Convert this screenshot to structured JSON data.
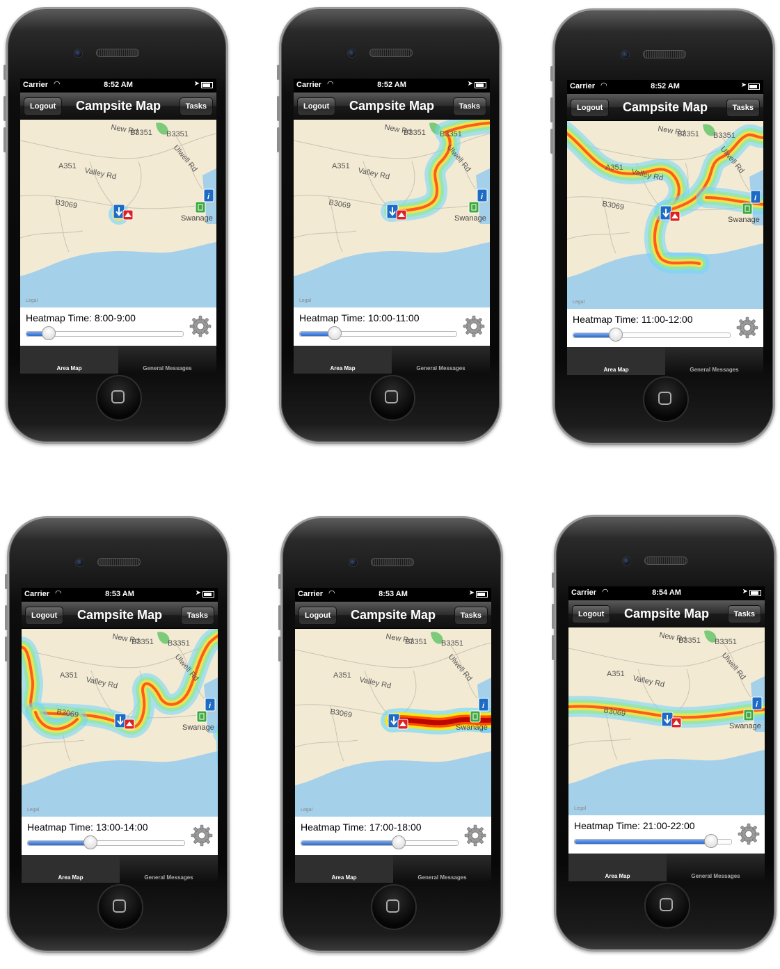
{
  "app": {
    "nav_title": "Campsite Map",
    "logout_label": "Logout",
    "tasks_label": "Tasks",
    "carrier": "Carrier",
    "map_legal": "Legal",
    "tab_area_map": "Area Map",
    "tab_general_messages": "General Messages",
    "slider_accent": "#2a69d3"
  },
  "map_labels": {
    "road_new": "New Rd",
    "b3351": "B3351",
    "b3351_b": "B3351",
    "ulwell": "Ulwell Rd",
    "a351": "A351",
    "valley": "Valley Rd",
    "b3069": "B3069",
    "swanage": "Swanage"
  },
  "screens": [
    {
      "time": "8:52 AM",
      "heatmap_label": "Heatmap Time: 8:00-9:00",
      "slider_fraction": 0.14
    },
    {
      "time": "8:52 AM",
      "heatmap_label": "Heatmap Time: 10:00-11:00",
      "slider_fraction": 0.22
    },
    {
      "time": "8:52 AM",
      "heatmap_label": "Heatmap Time: 11:00-12:00",
      "slider_fraction": 0.27
    },
    {
      "time": "8:53 AM",
      "heatmap_label": "Heatmap Time: 13:00-14:00",
      "slider_fraction": 0.4
    },
    {
      "time": "8:53 AM",
      "heatmap_label": "Heatmap Time: 17:00-18:00",
      "slider_fraction": 0.62
    },
    {
      "time": "8:54 AM",
      "heatmap_label": "Heatmap Time: 21:00-22:00",
      "slider_fraction": 0.87
    }
  ]
}
